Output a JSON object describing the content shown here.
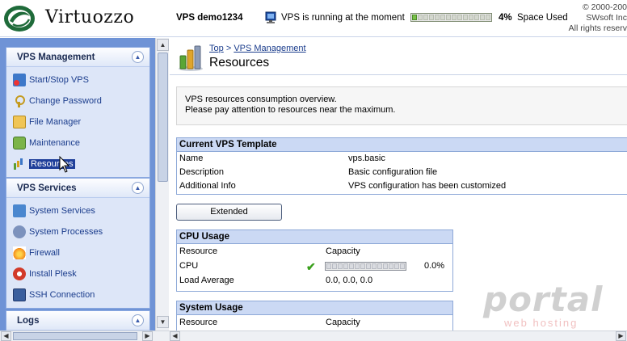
{
  "header": {
    "brand": "Virtuozzo",
    "vps_name": "VPS demo1234",
    "status_text": "VPS is running at the moment",
    "space_used_pct": 4,
    "space_used_value": "4%",
    "space_used_label": "Space Used",
    "copyright": "© 2000-200\nSWsoft Inc\nAll rights reserv"
  },
  "sidebar": {
    "management": {
      "title": "VPS Management",
      "items": [
        {
          "label": "Start/Stop VPS",
          "icon": "start-stop-icon"
        },
        {
          "label": "Change Password",
          "icon": "key-icon"
        },
        {
          "label": "File Manager",
          "icon": "folder-icon"
        },
        {
          "label": "Maintenance",
          "icon": "maintenance-icon"
        },
        {
          "label": "Resources",
          "icon": "resources-icon",
          "active": true
        }
      ]
    },
    "services": {
      "title": "VPS Services",
      "items": [
        {
          "label": "System Services",
          "icon": "system-services-icon"
        },
        {
          "label": "System Processes",
          "icon": "system-processes-icon"
        },
        {
          "label": "Firewall",
          "icon": "firewall-icon"
        },
        {
          "label": "Install Plesk",
          "icon": "plesk-icon"
        },
        {
          "label": "SSH Connection",
          "icon": "ssh-icon"
        }
      ]
    },
    "logs": {
      "title": "Logs"
    }
  },
  "main": {
    "breadcrumb": {
      "top": "Top",
      "separator": ">",
      "current": "VPS Management"
    },
    "title": "Resources",
    "description": {
      "line1": "VPS resources consumption overview.",
      "line2": "Please pay attention to resources near the maximum."
    },
    "template": {
      "title": "Current VPS Template",
      "rows": [
        {
          "key": "Name",
          "value": "vps.basic"
        },
        {
          "key": "Description",
          "value": "Basic configuration file"
        },
        {
          "key": "Additional Info",
          "value": "VPS configuration has been customized"
        }
      ]
    },
    "extended_button": "Extended",
    "cpu": {
      "title": "CPU Usage",
      "col_resource": "Resource",
      "col_capacity": "Capacity",
      "cpu_label": "CPU",
      "cpu_value": "0.0%",
      "cpu_fraction": 0,
      "load_label": "Load Average",
      "load_value": "0.0, 0.0, 0.0"
    },
    "system": {
      "title": "System Usage",
      "col_resource": "Resource",
      "col_capacity": "Capacity"
    }
  },
  "watermark": {
    "big": "portal",
    "small": "web hosting"
  },
  "colors": {
    "sidebar_bg": "#6f93d6",
    "panel_head": "#dfe8f8",
    "block_head": "#cbd9f4",
    "space_fill": "#79c04a",
    "link": "#1a3c8c",
    "ok_check": "#3aa01c"
  }
}
